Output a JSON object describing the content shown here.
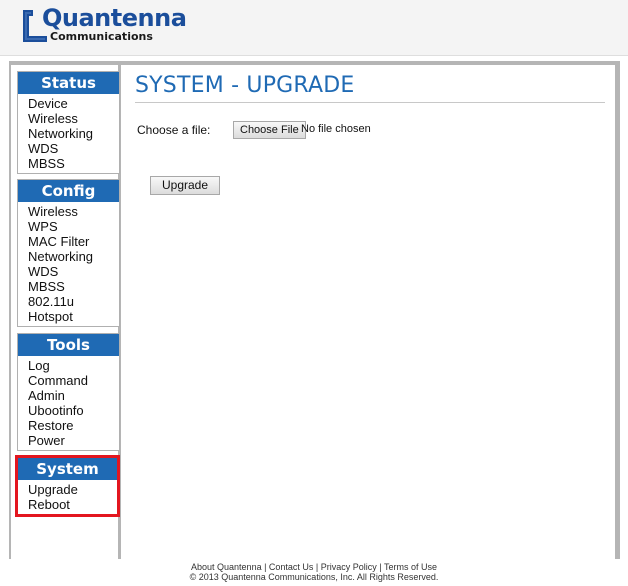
{
  "brand": {
    "name": "Quantenna",
    "tagline": "Communications",
    "color": "#1b4e9b"
  },
  "sidebar": {
    "groups": [
      {
        "title": "Status",
        "items": [
          "Device",
          "Wireless",
          "Networking",
          "WDS",
          "MBSS"
        ]
      },
      {
        "title": "Config",
        "items": [
          "Wireless",
          "WPS",
          "MAC Filter",
          "Networking",
          "WDS",
          "MBSS",
          "802.11u",
          "Hotspot"
        ]
      },
      {
        "title": "Tools",
        "items": [
          "Log",
          "Command",
          "Admin",
          "Ubootinfo",
          "Restore",
          "Power"
        ]
      },
      {
        "title": "System",
        "items": [
          "Upgrade",
          "Reboot"
        ],
        "highlight_color": "#e3161f"
      }
    ],
    "header_color": "#1f6ab4"
  },
  "main": {
    "title": "SYSTEM - UPGRADE",
    "file_label": "Choose a file:",
    "file_button": "Choose File",
    "file_status": "No file chosen",
    "upgrade_button": "Upgrade"
  },
  "footer": {
    "links": "About Quantenna | Contact Us | Privacy Policy | Terms of Use",
    "copyright": "© 2013 Quantenna Communications, Inc. All Rights Reserved."
  }
}
